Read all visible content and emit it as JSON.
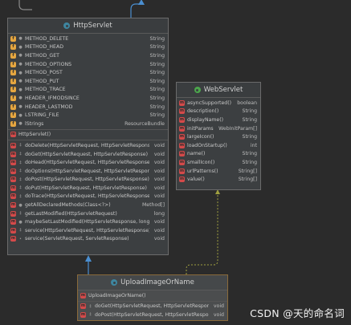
{
  "colors": {
    "field_icon": "#e5a640",
    "method_icon": "#d44a4a",
    "class_icon": "#4ca64c",
    "class_icon_alt": "#3e86a0",
    "extends_arrow": "#4a8ed0",
    "implements_line": "#a0a040"
  },
  "httpservlet": {
    "title": "HttpServlet",
    "fields": [
      {
        "name": "METHOD_DELETE",
        "type": "String"
      },
      {
        "name": "METHOD_HEAD",
        "type": "String"
      },
      {
        "name": "METHOD_GET",
        "type": "String"
      },
      {
        "name": "METHOD_OPTIONS",
        "type": "String"
      },
      {
        "name": "METHOD_POST",
        "type": "String"
      },
      {
        "name": "METHOD_PUT",
        "type": "String"
      },
      {
        "name": "METHOD_TRACE",
        "type": "String"
      },
      {
        "name": "HEADER_IFMODSINCE",
        "type": "String"
      },
      {
        "name": "HEADER_LASTMOD",
        "type": "String"
      },
      {
        "name": "LSTRING_FILE",
        "type": "String"
      },
      {
        "name": "lStrings",
        "type": "ResourceBundle"
      }
    ],
    "constructors": [
      {
        "name": "HttpServlet()",
        "type": ""
      }
    ],
    "methods": [
      {
        "name": "doDelete(HttpServletRequest, HttpServletResponse)",
        "type": "void"
      },
      {
        "name": "doGet(HttpServletRequest, HttpServletResponse)",
        "type": "void"
      },
      {
        "name": "doHead(HttpServletRequest, HttpServletResponse)",
        "type": "void"
      },
      {
        "name": "doOptions(HttpServletRequest, HttpServletResponse)",
        "type": "void"
      },
      {
        "name": "doPost(HttpServletRequest, HttpServletResponse)",
        "type": "void"
      },
      {
        "name": "doPut(HttpServletRequest, HttpServletResponse)",
        "type": "void"
      },
      {
        "name": "doTrace(HttpServletRequest, HttpServletResponse)",
        "type": "void"
      },
      {
        "name": "getAllDeclaredMethods(Class<?>)",
        "type": "Method[]"
      },
      {
        "name": "getLastModified(HttpServletRequest)",
        "type": "long"
      },
      {
        "name": "maybeSetLastModified(HttpServletResponse, long)",
        "type": "void"
      },
      {
        "name": "service(HttpServletRequest, HttpServletResponse)",
        "type": "void"
      },
      {
        "name": "service(ServletRequest, ServletResponse)",
        "type": "void"
      }
    ]
  },
  "webservlet": {
    "title": "WebServlet",
    "methods": [
      {
        "name": "asyncSupported()",
        "type": "boolean"
      },
      {
        "name": "description()",
        "type": "String"
      },
      {
        "name": "displayName()",
        "type": "String"
      },
      {
        "name": "initParams()",
        "type": "WebInitParam[]"
      },
      {
        "name": "largeIcon()",
        "type": "String"
      },
      {
        "name": "loadOnStartup()",
        "type": "int"
      },
      {
        "name": "name()",
        "type": "String"
      },
      {
        "name": "smallIcon()",
        "type": "String"
      },
      {
        "name": "urlPatterns()",
        "type": "String[]"
      },
      {
        "name": "value()",
        "type": "String[]"
      }
    ]
  },
  "uploadimage": {
    "title": "UploadImageOrName",
    "constructors": [
      {
        "name": "UploadImageOrName()",
        "type": ""
      }
    ],
    "methods": [
      {
        "name": "doGet(HttpServletRequest, HttpServletResponse)",
        "type": "void"
      },
      {
        "name": "doPost(HttpServletRequest, HttpServletResponse)",
        "type": "void"
      }
    ]
  },
  "watermark": "CSDN @天的命名词"
}
